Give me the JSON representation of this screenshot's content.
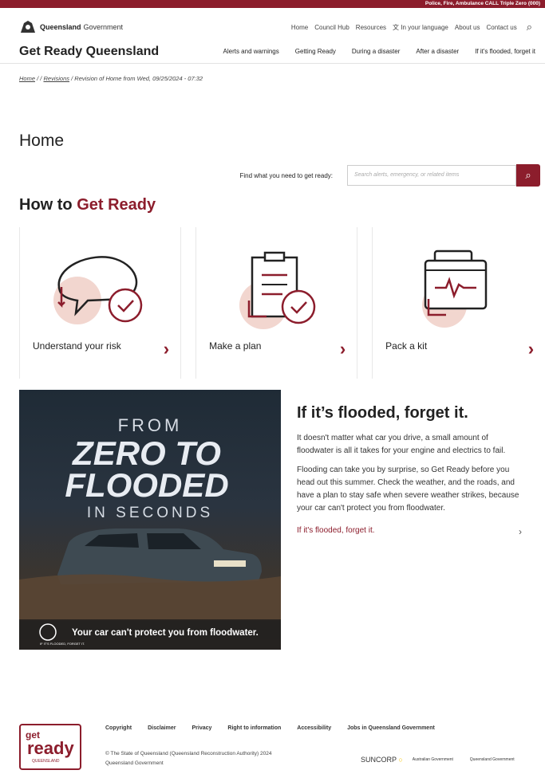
{
  "topbar": {
    "emergency": "Police, Fire, Ambulance CALL Triple Zero (000)"
  },
  "header": {
    "gov_name_bold": "Queensland",
    "gov_name_rest": "Government",
    "util_links": [
      "Home",
      "Council Hub",
      "Resources",
      "In your language",
      "About us",
      "Contact us"
    ],
    "site_title": "Get Ready Queensland",
    "main_nav": [
      "Alerts and warnings",
      "Getting Ready",
      "During a disaster",
      "After a disaster",
      "If it's flooded, forget it"
    ]
  },
  "breadcrumb": {
    "home": "Home",
    "sep1": "/",
    "sep2": "/",
    "revisions": "Revisions",
    "sep3": "/",
    "current": "Revision of Home from Wed, 09/25/2024 - 07:32"
  },
  "page_title": "Home",
  "search": {
    "label": "Find what you need to get ready:",
    "placeholder": "Search alerts, emergency, or related items"
  },
  "how_to": {
    "prefix": "How to ",
    "highlight": "Get Ready"
  },
  "cards": [
    {
      "label": "Understand your risk",
      "icon": "speech-bubble-check-icon"
    },
    {
      "label": "Make a plan",
      "icon": "clipboard-check-icon"
    },
    {
      "label": "Pack a kit",
      "icon": "first-aid-kit-icon"
    }
  ],
  "feature": {
    "image_text": {
      "line1": "FROM",
      "line2": "ZERO TO",
      "line3": "FLOODED",
      "line4": "IN SECONDS",
      "badge": "IF IT'S FLOODED, FORGET IT.",
      "tagline": "Your car can't protect you from floodwater."
    },
    "title": "If it’s flooded, forget it.",
    "para1": "It doesn't matter what car you drive, a small amount of floodwater is all it takes for your engine and electrics to fail.",
    "para2": "Flooding can take you by surprise, so Get Ready before you head out this summer.  Check the weather, and the roads, and have a plan to stay safe when severe weather strikes, because your car can't protect you from floodwater.",
    "link": "If it's flooded, forget it."
  },
  "footer": {
    "logo_get": "get",
    "logo_ready": "ready",
    "logo_sub": "QUEENSLAND",
    "links": [
      "Copyright",
      "Disclaimer",
      "Privacy",
      "Right to information",
      "Accessibility",
      "Jobs in Queensland Government"
    ],
    "copy1": "© The State of Queensland (Queensland Reconstruction Authority) 2024",
    "copy2": "Queensland Government",
    "sponsor1": "SUNCORP",
    "sponsor2": "Australian Government",
    "sponsor3": "Queensland Government"
  },
  "colors": {
    "brand": "#8c1d2c",
    "accent_circle": "#f2d6cf"
  }
}
